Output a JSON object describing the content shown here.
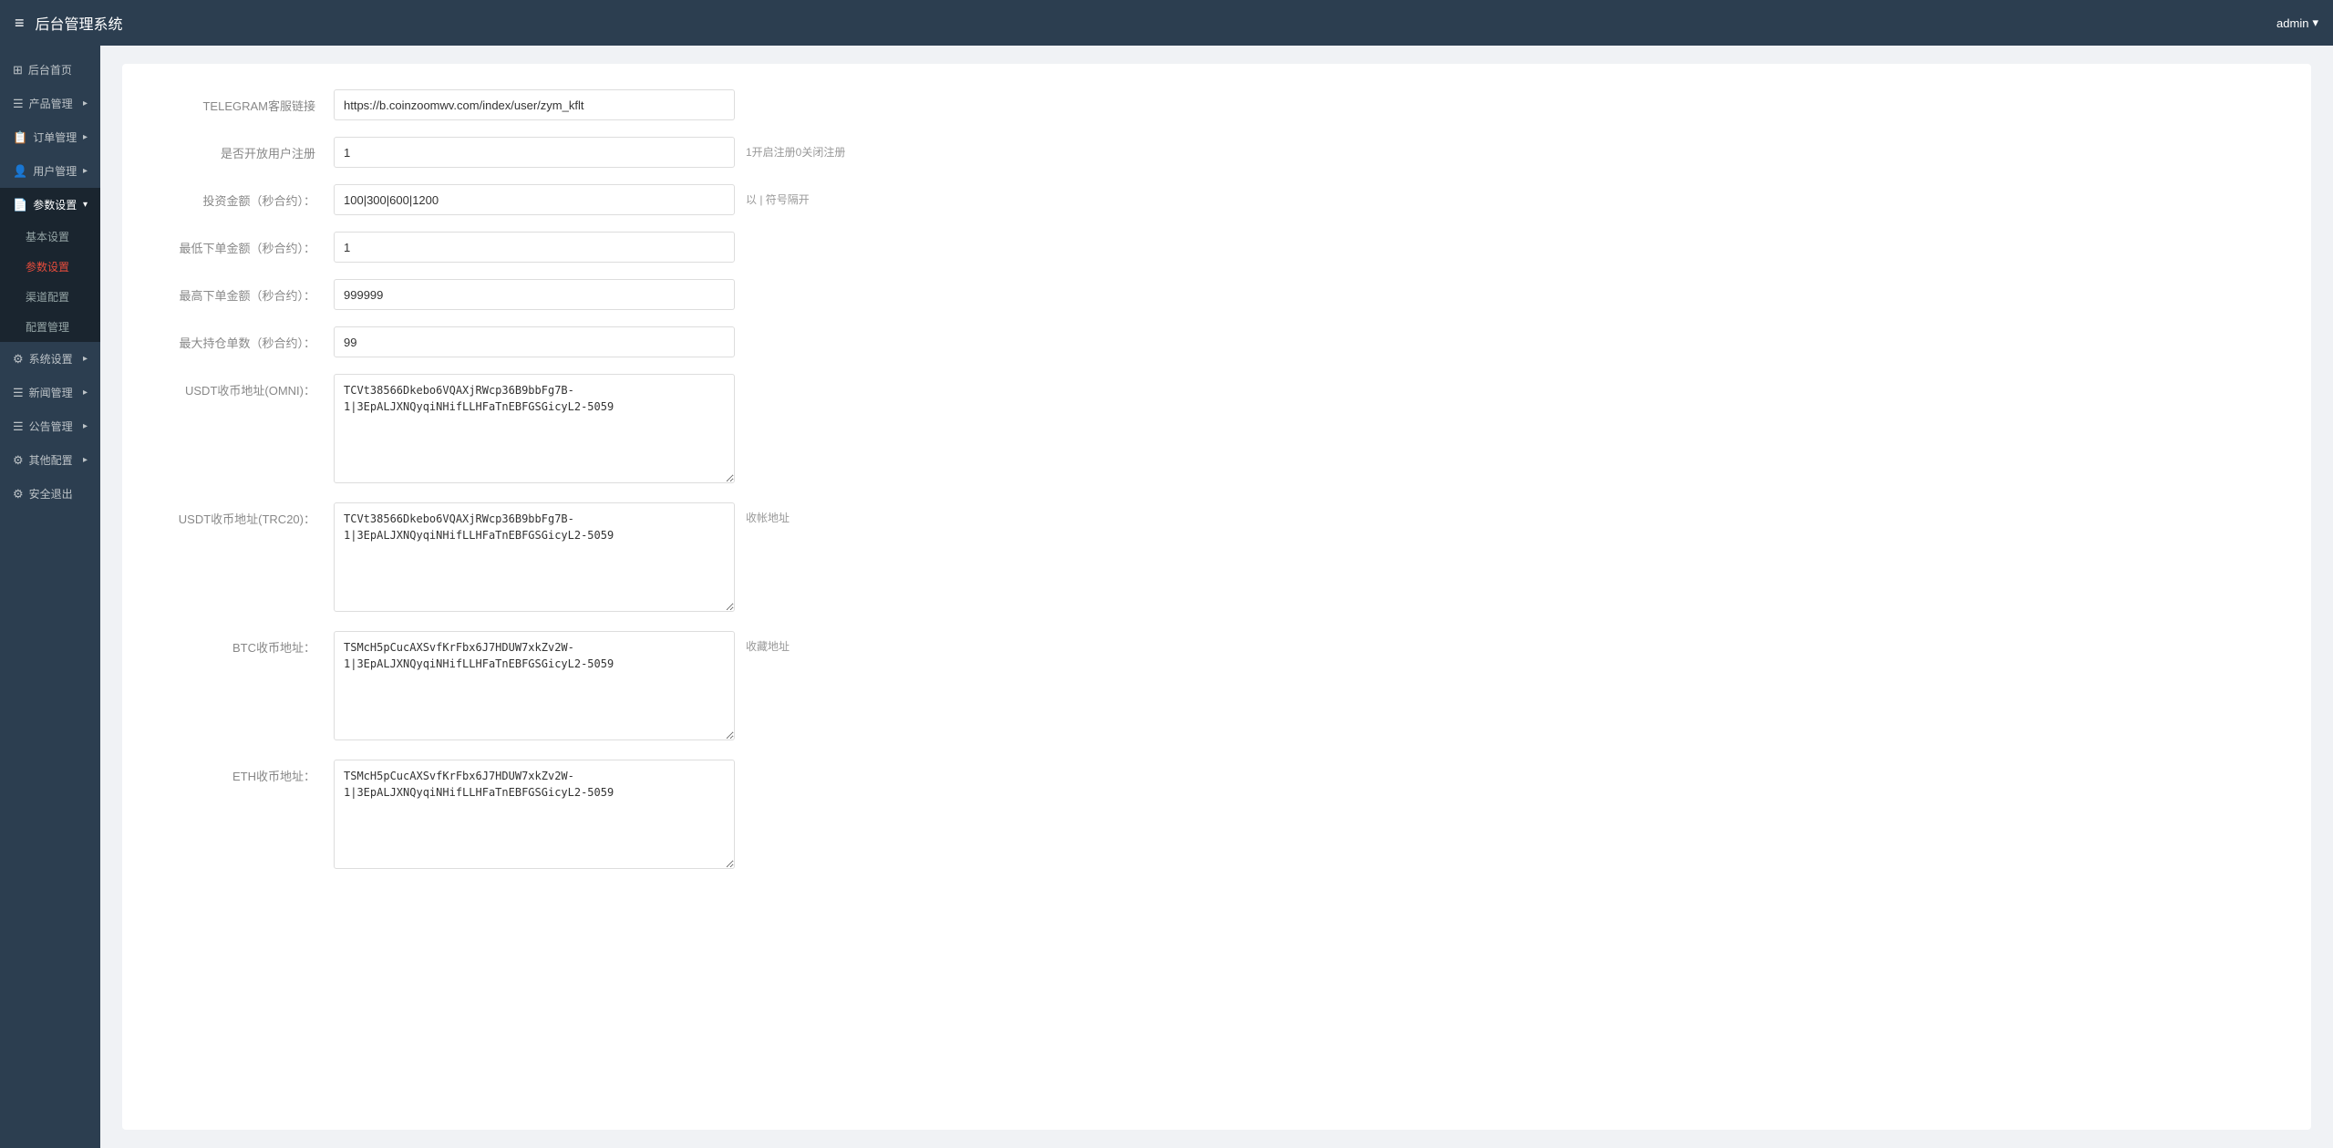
{
  "header": {
    "hamburger": "≡",
    "title": "后台管理系统",
    "user": "admin",
    "user_arrow": "▾"
  },
  "sidebar": {
    "items": [
      {
        "id": "dashboard",
        "icon": "⊞",
        "label": "后台首页",
        "arrow": "",
        "active": false,
        "submenu": []
      },
      {
        "id": "products",
        "icon": "☰",
        "label": "产品管理",
        "arrow": "▸",
        "active": false,
        "submenu": []
      },
      {
        "id": "orders",
        "icon": "📋",
        "label": "订单管理",
        "arrow": "▸",
        "active": false,
        "submenu": []
      },
      {
        "id": "users",
        "icon": "👤",
        "label": "用户管理",
        "arrow": "▸",
        "active": false,
        "submenu": []
      },
      {
        "id": "params",
        "icon": "📄",
        "label": "参数设置",
        "arrow": "▾",
        "active": true,
        "submenu": [
          {
            "id": "basic",
            "label": "基本设置",
            "active": false
          },
          {
            "id": "params-sub",
            "label": "参数设置",
            "active": true
          },
          {
            "id": "channel",
            "label": "渠道配置",
            "active": false
          },
          {
            "id": "config",
            "label": "配置管理",
            "active": false
          }
        ]
      },
      {
        "id": "system",
        "icon": "⚙",
        "label": "系统设置",
        "arrow": "▸",
        "active": false,
        "submenu": []
      },
      {
        "id": "news",
        "icon": "☰",
        "label": "新闻管理",
        "arrow": "▸",
        "active": false,
        "submenu": []
      },
      {
        "id": "announcement",
        "icon": "☰",
        "label": "公告管理",
        "arrow": "▸",
        "active": false,
        "submenu": []
      },
      {
        "id": "other",
        "icon": "⚙",
        "label": "其他配置",
        "arrow": "▸",
        "active": false,
        "submenu": []
      },
      {
        "id": "logout",
        "icon": "⚙",
        "label": "安全退出",
        "arrow": "",
        "active": false,
        "submenu": []
      }
    ]
  },
  "form": {
    "fields": [
      {
        "id": "telegram-link",
        "label": "TELEGRAM客服链接",
        "type": "input",
        "value": "https://b.coinzoomwv.com/index/user/zym_kflt",
        "hint": ""
      },
      {
        "id": "user-register",
        "label": "是否开放用户注册",
        "type": "input",
        "value": "1",
        "hint": "1开启注册0关闭注册"
      },
      {
        "id": "invest-amount",
        "label": "投资金额（秒合约）：",
        "type": "input",
        "value": "100|300|600|1200",
        "hint": "以 | 符号隔开"
      },
      {
        "id": "min-order",
        "label": "最低下单金额（秒合约）：",
        "type": "input",
        "value": "1",
        "hint": ""
      },
      {
        "id": "max-order",
        "label": "最高下单金额（秒合约）：",
        "type": "input",
        "value": "999999",
        "hint": ""
      },
      {
        "id": "max-position",
        "label": "最大持仓单数（秒合约）：",
        "type": "input",
        "value": "99",
        "hint": ""
      },
      {
        "id": "usdt-omni",
        "label": "USDT收币地址(OMNI)：",
        "type": "textarea",
        "value": "TCVt38566Dkebo6VQAXjRWcp36B9bbFg7B-1|3EpALJXNQyqiNHifLLHFaTnEBFGSGicyL2-5059",
        "hint": ""
      },
      {
        "id": "usdt-trc20",
        "label": "USDT收币地址(TRC20)：",
        "type": "textarea",
        "value": "TCVt38566Dkebo6VQAXjRWcp36B9bbFg7B-1|3EpALJXNQyqiNHifLLHFaTnEBFGSGicyL2-5059",
        "hint": "收帐地址"
      },
      {
        "id": "btc-address",
        "label": "BTC收币地址：",
        "type": "textarea",
        "value": "TSMcH5pCucAXSvfKrFbx6J7HDUW7xkZv2W-1|3EpALJXNQyqiNHifLLHFaTnEBFGSGicyL2-5059",
        "hint": "收藏地址"
      },
      {
        "id": "eth-address",
        "label": "ETH收币地址：",
        "type": "textarea",
        "value": "TSMcH5pCucAXSvfKrFbx6J7HDUW7xkZv2W-1|3EpALJXNQyqiNHifLLHFaTnEBFGSGicyL2-5059",
        "hint": ""
      }
    ]
  }
}
